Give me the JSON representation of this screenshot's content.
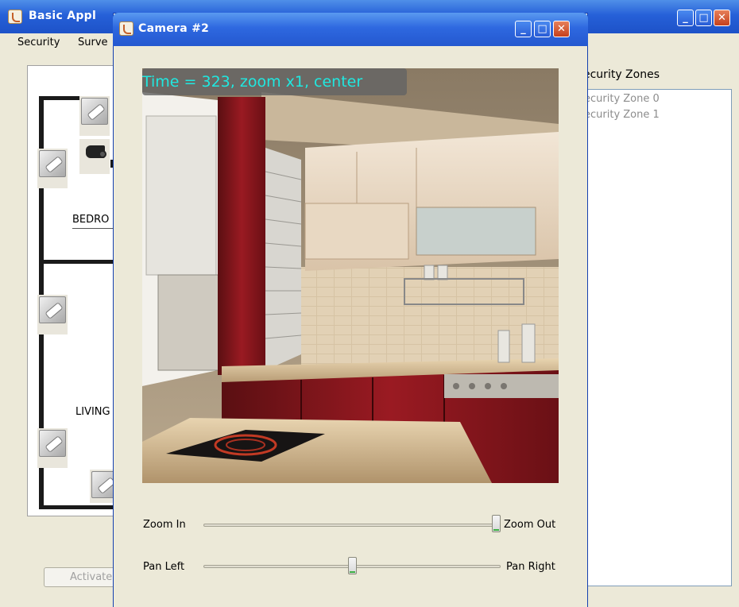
{
  "main_window": {
    "title": "Basic Appl",
    "menu": [
      "Security",
      "Surve"
    ],
    "floorplan": {
      "room_labels": [
        "BEDRO",
        "LIVING"
      ]
    },
    "zones": {
      "header": "ecurity Zones",
      "items": [
        "ecurity Zone 0",
        "ecurity Zone 1"
      ]
    },
    "activate_label": "Activate"
  },
  "camera_window": {
    "title": "Camera #2",
    "overlay_text": "Time = 323, zoom x1, center",
    "zoom": {
      "left_label": "Zoom In",
      "right_label": "Zoom Out",
      "value_fraction": 1.0
    },
    "pan": {
      "left_label": "Pan Left",
      "right_label": "Pan Right",
      "value_fraction": 0.5
    }
  },
  "colors": {
    "titlebar_blue": "#2660d8",
    "overlay_text": "#20e8e0",
    "dialog_bg": "#ece9d8"
  },
  "icons": [
    "app-icon",
    "minimize-icon",
    "maximize-icon",
    "close-icon",
    "security-camera-icon",
    "motion-sensor-icon"
  ]
}
